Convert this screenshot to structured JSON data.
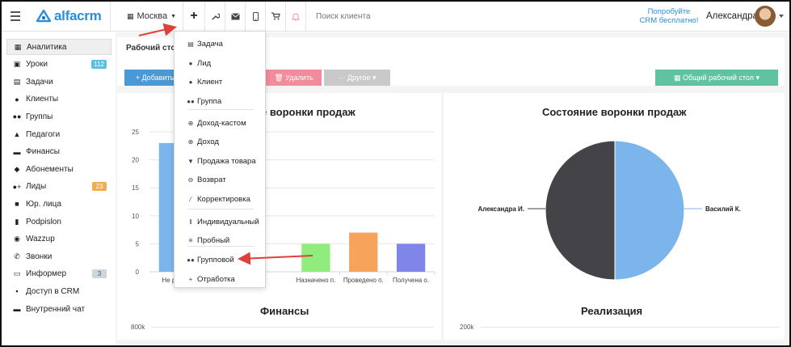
{
  "topbar": {
    "logo_text": "alfacrm",
    "city": "Москва",
    "search_placeholder": "Поиск клиента",
    "try_line1": "Попробуйте",
    "try_line2": "CRM бесплатно!",
    "user_name": "Александра"
  },
  "sidebar": {
    "items": [
      {
        "label": "Аналитика",
        "icon": "book-icon",
        "glyph": "▦"
      },
      {
        "label": "Уроки",
        "icon": "calendar-icon",
        "glyph": "▣",
        "badge": "112"
      },
      {
        "label": "Задачи",
        "icon": "tasks-icon",
        "glyph": "▤"
      },
      {
        "label": "Клиенты",
        "icon": "user-icon",
        "glyph": "●"
      },
      {
        "label": "Группы",
        "icon": "users-icon",
        "glyph": "●●"
      },
      {
        "label": "Педагоги",
        "icon": "graduation-cap-icon",
        "glyph": "▲"
      },
      {
        "label": "Финансы",
        "icon": "money-icon",
        "glyph": "▬"
      },
      {
        "label": "Абонементы",
        "icon": "tag-icon",
        "glyph": "◆"
      },
      {
        "label": "Лиды",
        "icon": "user-plus-icon",
        "glyph": "●+",
        "badge": "23"
      },
      {
        "label": "Юр. лица",
        "icon": "briefcase-icon",
        "glyph": "■"
      },
      {
        "label": "Podpislon",
        "icon": "document-icon",
        "glyph": "▮"
      },
      {
        "label": "Wazzup",
        "icon": "whatsapp-icon",
        "glyph": "◉"
      },
      {
        "label": "Звонки",
        "icon": "phone-icon",
        "glyph": "✆"
      },
      {
        "label": "Информер",
        "icon": "inbox-icon",
        "glyph": "▭",
        "badge": "3"
      },
      {
        "label": "Доступ в CRM",
        "icon": "lock-icon",
        "glyph": "▪"
      },
      {
        "label": "Внутренний чат",
        "icon": "chat-icon",
        "glyph": "▬"
      }
    ]
  },
  "header": {
    "title": "Рабочий стол",
    "add_label": "+ Добавить",
    "delete_label": "🗑 Удалить",
    "other_label": "··· Другое ▾",
    "desk_label": "▦  Общий рабочий стол ▾"
  },
  "menu": {
    "items": [
      {
        "label": "Задача",
        "icon": "task-icon",
        "glyph": "▤"
      },
      {
        "label": "Лид",
        "icon": "user-icon",
        "glyph": "●"
      },
      {
        "label": "Клиент",
        "icon": "user-icon",
        "glyph": "●"
      },
      {
        "label": "Группа",
        "icon": "users-icon",
        "glyph": "●●"
      },
      {
        "label": "Доход-кастом",
        "icon": "circle-arrow-icon",
        "glyph": "⊕"
      },
      {
        "label": "Доход",
        "icon": "circle-arrow-icon",
        "glyph": "⊕"
      },
      {
        "label": "Продажа товара",
        "icon": "cart-icon",
        "glyph": "▼"
      },
      {
        "label": "Возврат",
        "icon": "circle-minus-icon",
        "glyph": "⊖"
      },
      {
        "label": "Корректировка",
        "icon": "wand-icon",
        "glyph": "⁄"
      },
      {
        "label": "Индивидуальный",
        "icon": "bars-icon",
        "glyph": "‖"
      },
      {
        "label": "Пробный",
        "icon": "asterisk-icon",
        "glyph": "✳"
      },
      {
        "label": "Групповой",
        "icon": "users-icon",
        "glyph": "●●"
      },
      {
        "label": "Отработка",
        "icon": "plus-icon",
        "glyph": "+"
      }
    ]
  },
  "colors": {
    "accent": "#4a98d6",
    "danger": "#f28b9c",
    "success": "#5fc3a3",
    "arrow": "#e0403a"
  },
  "chart_data": [
    {
      "type": "bar",
      "title": "Состояние воронки продаж",
      "title_visible": "е воронки продаж",
      "categories": [
        "Не ра...",
        "Назначено п.",
        "Проведено п.",
        "Получена о."
      ],
      "values": [
        23,
        5,
        7,
        5
      ],
      "colors": [
        "#7cb5ec",
        "#90ed7d",
        "#f7a35c",
        "#8085e9"
      ],
      "ylim": [
        0,
        25
      ],
      "yticks": [
        0,
        5,
        10,
        15,
        20,
        25
      ],
      "grid": true,
      "hidden_middle_bars": 2
    },
    {
      "type": "pie",
      "title": "Состояние воронки продаж",
      "slices": [
        {
          "label": "Александра И.",
          "value": 50,
          "color": "#434348"
        },
        {
          "label": "Василий К.",
          "value": 50,
          "color": "#7cb5ec"
        }
      ]
    }
  ],
  "bottom": {
    "finance_title": "Финансы",
    "finance_tick": "800k",
    "sales_title": "Реализация",
    "sales_tick": "200k"
  }
}
